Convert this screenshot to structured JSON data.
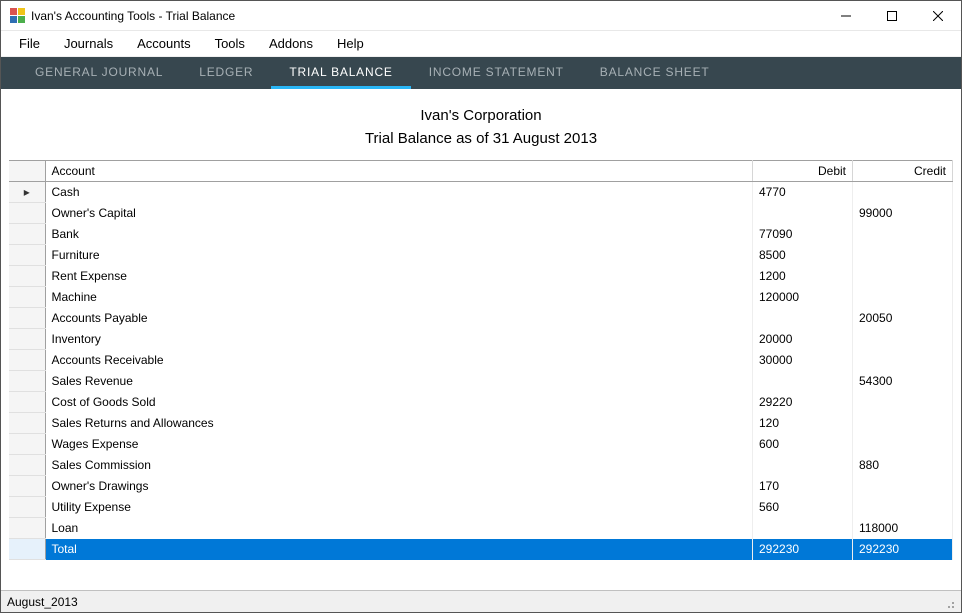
{
  "window": {
    "title": "Ivan's Accounting Tools - Trial Balance"
  },
  "menu": {
    "file": "File",
    "journals": "Journals",
    "accounts": "Accounts",
    "tools": "Tools",
    "addons": "Addons",
    "help": "Help"
  },
  "tabs": {
    "general_journal": "GENERAL JOURNAL",
    "ledger": "LEDGER",
    "trial_balance": "TRIAL BALANCE",
    "income_statement": "INCOME STATEMENT",
    "balance_sheet": "BALANCE SHEET"
  },
  "report": {
    "company": "Ivan's Corporation",
    "subtitle": "Trial Balance as of 31 August 2013"
  },
  "columns": {
    "account": "Account",
    "debit": "Debit",
    "credit": "Credit"
  },
  "rows": [
    {
      "indicator": "▸",
      "account": "Cash",
      "debit": "4770",
      "credit": ""
    },
    {
      "indicator": "",
      "account": "Owner's Capital",
      "debit": "",
      "credit": "99000"
    },
    {
      "indicator": "",
      "account": "Bank",
      "debit": "77090",
      "credit": ""
    },
    {
      "indicator": "",
      "account": "Furniture",
      "debit": "8500",
      "credit": ""
    },
    {
      "indicator": "",
      "account": "Rent Expense",
      "debit": "1200",
      "credit": ""
    },
    {
      "indicator": "",
      "account": "Machine",
      "debit": "120000",
      "credit": ""
    },
    {
      "indicator": "",
      "account": "Accounts Payable",
      "debit": "",
      "credit": "20050"
    },
    {
      "indicator": "",
      "account": "Inventory",
      "debit": "20000",
      "credit": ""
    },
    {
      "indicator": "",
      "account": "Accounts Receivable",
      "debit": "30000",
      "credit": ""
    },
    {
      "indicator": "",
      "account": "Sales Revenue",
      "debit": "",
      "credit": "54300"
    },
    {
      "indicator": "",
      "account": "Cost of Goods Sold",
      "debit": "29220",
      "credit": ""
    },
    {
      "indicator": "",
      "account": "Sales Returns and Allowances",
      "debit": "120",
      "credit": ""
    },
    {
      "indicator": "",
      "account": "Wages Expense",
      "debit": "600",
      "credit": ""
    },
    {
      "indicator": "",
      "account": "Sales Commission",
      "debit": "",
      "credit": "880"
    },
    {
      "indicator": "",
      "account": "Owner's Drawings",
      "debit": "170",
      "credit": ""
    },
    {
      "indicator": "",
      "account": "Utility Expense",
      "debit": "560",
      "credit": ""
    },
    {
      "indicator": "",
      "account": "Loan",
      "debit": "",
      "credit": "118000"
    }
  ],
  "total": {
    "account": "Total",
    "debit": "292230",
    "credit": "292230"
  },
  "status": {
    "text": "August_2013"
  }
}
